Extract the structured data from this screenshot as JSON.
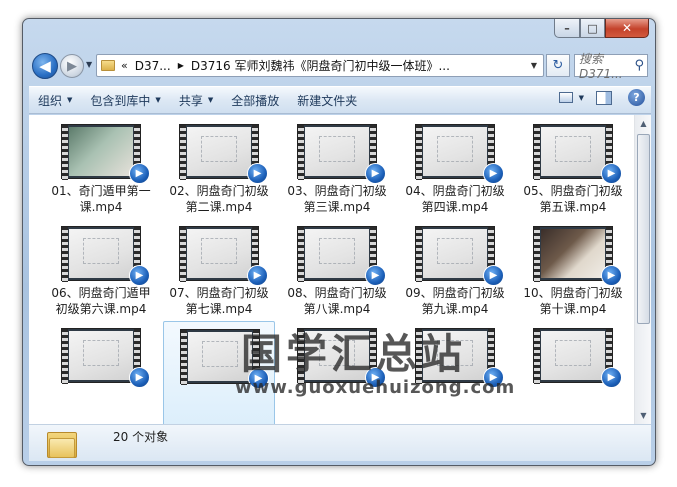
{
  "window": {
    "captions": {
      "minimize": "–",
      "maximize": "□",
      "close": "✕"
    }
  },
  "nav": {
    "back_glyph": "◀",
    "forward_glyph": "▶",
    "recent_glyph": "▼",
    "address": {
      "more": "«",
      "crumbs": [
        "D37...",
        "D3716 军师刘魏祎《阴盘奇门初中级一体班》..."
      ],
      "separator": "▶",
      "dropdown": "▼"
    },
    "refresh_glyph": "↻",
    "search_placeholder": "搜索 D371...",
    "search_glyph": "⚲"
  },
  "toolbar": {
    "organize": "组织",
    "include_in_library": "包含到库中",
    "share": "共享",
    "play_all": "全部播放",
    "new_folder": "新建文件夹",
    "dropdown_glyph": "▼",
    "help_glyph": "?"
  },
  "files": [
    {
      "name": "01、奇门遁甲第一课.mp4",
      "thumb": "green"
    },
    {
      "name": "02、阴盘奇门初级第二课.mp4",
      "thumb": "board"
    },
    {
      "name": "03、阴盘奇门初级第三课.mp4",
      "thumb": "board"
    },
    {
      "name": "04、阴盘奇门初级第四课.mp4",
      "thumb": "board"
    },
    {
      "name": "05、阴盘奇门初级第五课.mp4",
      "thumb": "board"
    },
    {
      "name": "06、阴盘奇门遁甲初级第六课.mp4",
      "thumb": "board"
    },
    {
      "name": "07、阴盘奇门初级第七课.mp4",
      "thumb": "board"
    },
    {
      "name": "08、阴盘奇门初级第八课.mp4",
      "thumb": "board"
    },
    {
      "name": "09、阴盘奇门初级第九课.mp4",
      "thumb": "board"
    },
    {
      "name": "10、阴盘奇门初级第十课.mp4",
      "thumb": "dark"
    },
    {
      "name": "",
      "thumb": "board"
    },
    {
      "name": "",
      "thumb": "board",
      "selected": true
    },
    {
      "name": "",
      "thumb": "board"
    },
    {
      "name": "",
      "thumb": "board"
    },
    {
      "name": "",
      "thumb": "board"
    }
  ],
  "watermark": {
    "text": "国学汇总站",
    "url": "www.guoxuehuizong.com"
  },
  "scrollbar": {
    "up": "▲",
    "down": "▼"
  },
  "details": {
    "count": "20 个对象"
  }
}
